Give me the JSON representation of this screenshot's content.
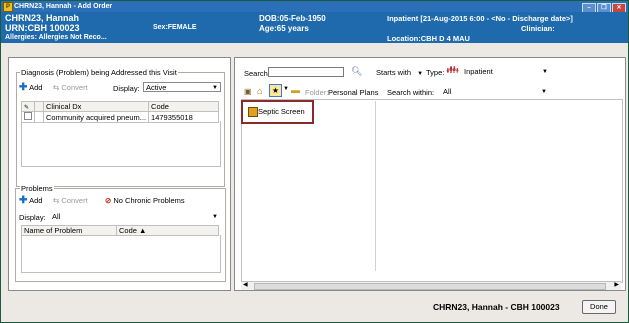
{
  "window": {
    "title": "CHRN23, Hannah - Add Order",
    "buttons": [
      "–",
      "❐",
      "✕"
    ]
  },
  "banner": {
    "name": "CHRN23, Hannah",
    "urn": "URN:CBH 100023",
    "sex": "Sex:FEMALE",
    "allergies": "Allergies: Allergies Not Reco...",
    "dob": "DOB:05-Feb-1950",
    "age": "Age:65 years",
    "encounter": "Inpatient [21-Aug-2015 6:00 - <No - Discharge date>]",
    "clinician": "Clinician:",
    "location": "Location:CBH D 4 MAU"
  },
  "diagnosis": {
    "group_title": "Diagnosis (Problem) being Addressed this Visit",
    "add_label": "Add",
    "convert_label": "Convert",
    "display_label": "Display:",
    "display_value": "Active",
    "columns": [
      "Clinical Dx",
      "Code"
    ],
    "rows": [
      {
        "dx": "Community acquired pneum...",
        "code": "1479355018"
      }
    ]
  },
  "problems": {
    "group_title": "Problems",
    "add_label": "Add",
    "convert_label": "Convert",
    "no_chronic_label": "No Chronic Problems",
    "display_label": "Display:",
    "display_value": "All",
    "columns": [
      "Name of Problem",
      "Code ▲"
    ]
  },
  "search": {
    "label": "Search:",
    "value": "",
    "starts_with": "Starts with",
    "type_label": "Type:",
    "type_value": "Inpatient",
    "folder_label": "Folder:",
    "folder_value": "Personal Plans",
    "within_label": "Search within:",
    "within_value": "All"
  },
  "plans": {
    "items": [
      "Septic Screen"
    ]
  },
  "footer": {
    "patient": "CHRN23, Hannah - CBH 100023",
    "done_label": "Done"
  },
  "colors": {
    "banner": "#1f6aad",
    "titlebar": "#2a6fb8",
    "highlight_border": "#8a2a2a"
  }
}
